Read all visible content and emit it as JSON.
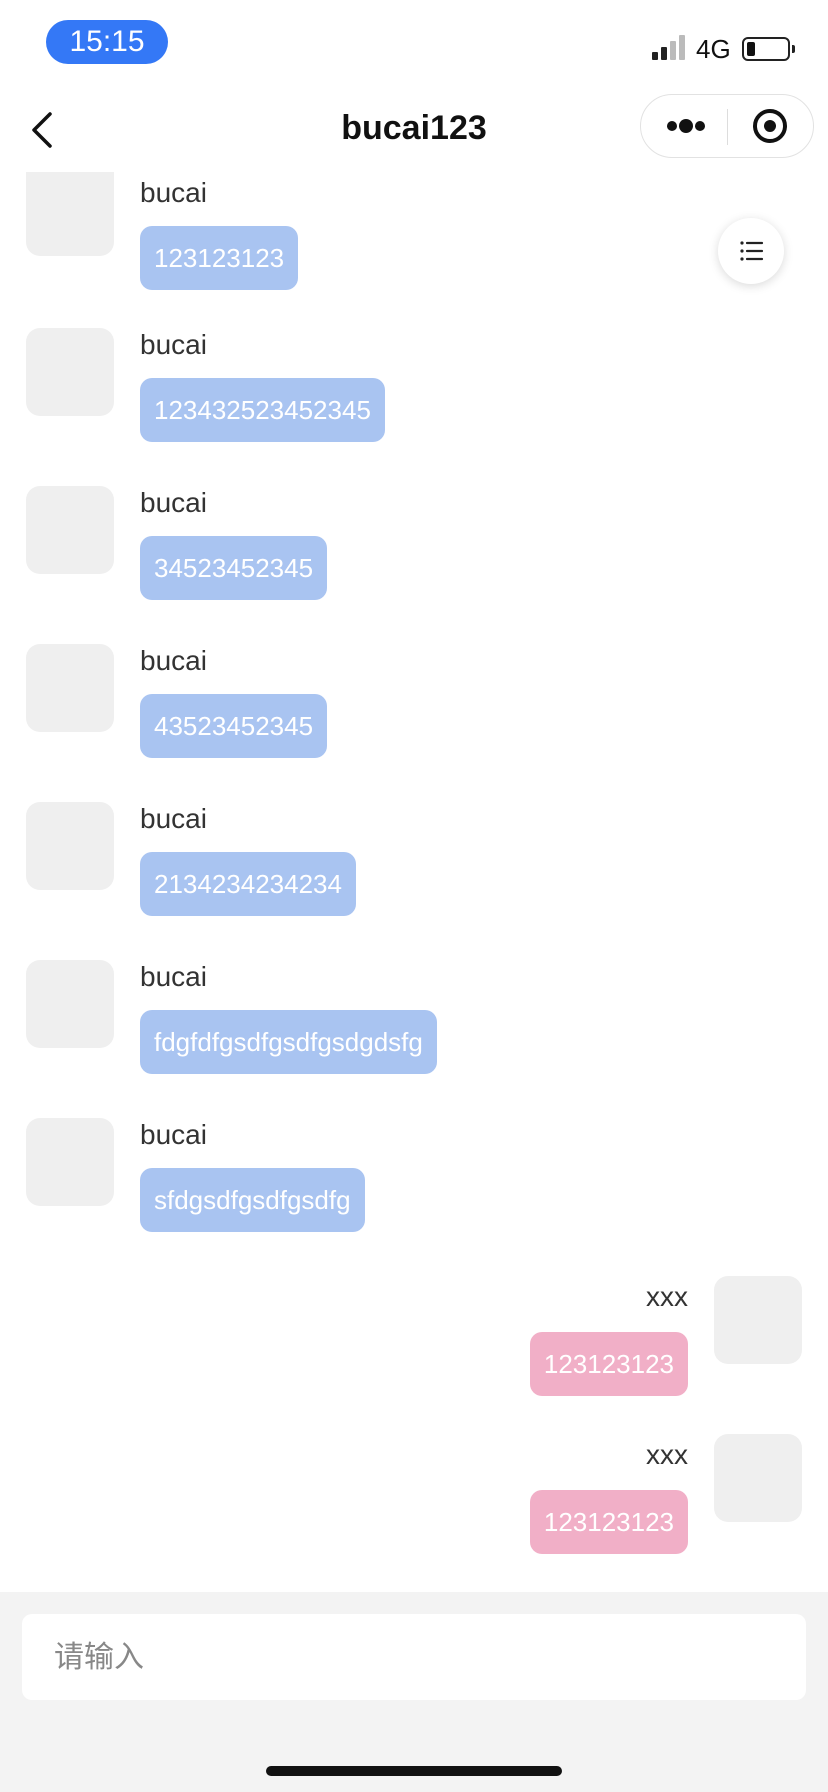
{
  "status_bar": {
    "time": "15:15",
    "network": "4G",
    "time_pill_color": "#3478f6"
  },
  "nav": {
    "title": "bucai123",
    "back_icon": "chevron-left-icon",
    "more_icon": "more-dots-icon",
    "close_icon": "target-close-icon"
  },
  "messages": [
    {
      "side": "left",
      "sender": "bucai",
      "text": "123123123"
    },
    {
      "side": "left",
      "sender": "bucai",
      "text": "123432523452345"
    },
    {
      "side": "left",
      "sender": "bucai",
      "text": "34523452345"
    },
    {
      "side": "left",
      "sender": "bucai",
      "text": "43523452345"
    },
    {
      "side": "left",
      "sender": "bucai",
      "text": "2134234234234"
    },
    {
      "side": "left",
      "sender": "bucai",
      "text": "fdgfdfgsdfgsdfgsdgdsfg"
    },
    {
      "side": "left",
      "sender": "bucai",
      "text": "sfdgsdfgsdfgsdfg"
    },
    {
      "side": "right",
      "sender": "xxx",
      "text": "123123123"
    },
    {
      "side": "right",
      "sender": "xxx",
      "text": "123123123"
    }
  ],
  "colors": {
    "incoming_bubble": "#a9c4f1",
    "outgoing_bubble": "#f1afc7",
    "avatar_placeholder": "#efefef"
  },
  "input": {
    "placeholder": "请输入",
    "value": ""
  }
}
